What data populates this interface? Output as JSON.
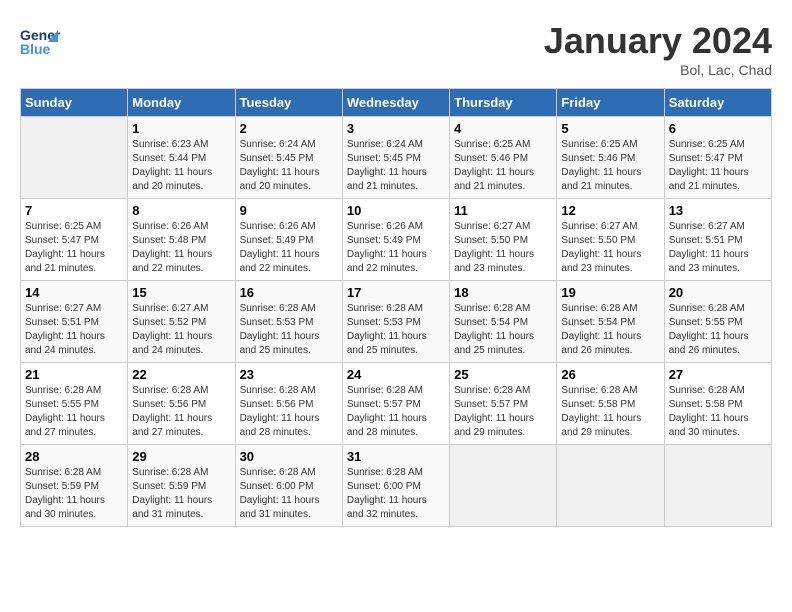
{
  "header": {
    "logo_text_general": "General",
    "logo_text_blue": "Blue",
    "title": "January 2024",
    "location": "Bol, Lac, Chad"
  },
  "days_of_week": [
    "Sunday",
    "Monday",
    "Tuesday",
    "Wednesday",
    "Thursday",
    "Friday",
    "Saturday"
  ],
  "weeks": [
    [
      {
        "num": "",
        "sunrise": "",
        "sunset": "",
        "daylight": ""
      },
      {
        "num": "1",
        "sunrise": "Sunrise: 6:23 AM",
        "sunset": "Sunset: 5:44 PM",
        "daylight": "Daylight: 11 hours and 20 minutes."
      },
      {
        "num": "2",
        "sunrise": "Sunrise: 6:24 AM",
        "sunset": "Sunset: 5:45 PM",
        "daylight": "Daylight: 11 hours and 20 minutes."
      },
      {
        "num": "3",
        "sunrise": "Sunrise: 6:24 AM",
        "sunset": "Sunset: 5:45 PM",
        "daylight": "Daylight: 11 hours and 21 minutes."
      },
      {
        "num": "4",
        "sunrise": "Sunrise: 6:25 AM",
        "sunset": "Sunset: 5:46 PM",
        "daylight": "Daylight: 11 hours and 21 minutes."
      },
      {
        "num": "5",
        "sunrise": "Sunrise: 6:25 AM",
        "sunset": "Sunset: 5:46 PM",
        "daylight": "Daylight: 11 hours and 21 minutes."
      },
      {
        "num": "6",
        "sunrise": "Sunrise: 6:25 AM",
        "sunset": "Sunset: 5:47 PM",
        "daylight": "Daylight: 11 hours and 21 minutes."
      }
    ],
    [
      {
        "num": "7",
        "sunrise": "Sunrise: 6:25 AM",
        "sunset": "Sunset: 5:47 PM",
        "daylight": "Daylight: 11 hours and 21 minutes."
      },
      {
        "num": "8",
        "sunrise": "Sunrise: 6:26 AM",
        "sunset": "Sunset: 5:48 PM",
        "daylight": "Daylight: 11 hours and 22 minutes."
      },
      {
        "num": "9",
        "sunrise": "Sunrise: 6:26 AM",
        "sunset": "Sunset: 5:49 PM",
        "daylight": "Daylight: 11 hours and 22 minutes."
      },
      {
        "num": "10",
        "sunrise": "Sunrise: 6:26 AM",
        "sunset": "Sunset: 5:49 PM",
        "daylight": "Daylight: 11 hours and 22 minutes."
      },
      {
        "num": "11",
        "sunrise": "Sunrise: 6:27 AM",
        "sunset": "Sunset: 5:50 PM",
        "daylight": "Daylight: 11 hours and 23 minutes."
      },
      {
        "num": "12",
        "sunrise": "Sunrise: 6:27 AM",
        "sunset": "Sunset: 5:50 PM",
        "daylight": "Daylight: 11 hours and 23 minutes."
      },
      {
        "num": "13",
        "sunrise": "Sunrise: 6:27 AM",
        "sunset": "Sunset: 5:51 PM",
        "daylight": "Daylight: 11 hours and 23 minutes."
      }
    ],
    [
      {
        "num": "14",
        "sunrise": "Sunrise: 6:27 AM",
        "sunset": "Sunset: 5:51 PM",
        "daylight": "Daylight: 11 hours and 24 minutes."
      },
      {
        "num": "15",
        "sunrise": "Sunrise: 6:27 AM",
        "sunset": "Sunset: 5:52 PM",
        "daylight": "Daylight: 11 hours and 24 minutes."
      },
      {
        "num": "16",
        "sunrise": "Sunrise: 6:28 AM",
        "sunset": "Sunset: 5:53 PM",
        "daylight": "Daylight: 11 hours and 25 minutes."
      },
      {
        "num": "17",
        "sunrise": "Sunrise: 6:28 AM",
        "sunset": "Sunset: 5:53 PM",
        "daylight": "Daylight: 11 hours and 25 minutes."
      },
      {
        "num": "18",
        "sunrise": "Sunrise: 6:28 AM",
        "sunset": "Sunset: 5:54 PM",
        "daylight": "Daylight: 11 hours and 25 minutes."
      },
      {
        "num": "19",
        "sunrise": "Sunrise: 6:28 AM",
        "sunset": "Sunset: 5:54 PM",
        "daylight": "Daylight: 11 hours and 26 minutes."
      },
      {
        "num": "20",
        "sunrise": "Sunrise: 6:28 AM",
        "sunset": "Sunset: 5:55 PM",
        "daylight": "Daylight: 11 hours and 26 minutes."
      }
    ],
    [
      {
        "num": "21",
        "sunrise": "Sunrise: 6:28 AM",
        "sunset": "Sunset: 5:55 PM",
        "daylight": "Daylight: 11 hours and 27 minutes."
      },
      {
        "num": "22",
        "sunrise": "Sunrise: 6:28 AM",
        "sunset": "Sunset: 5:56 PM",
        "daylight": "Daylight: 11 hours and 27 minutes."
      },
      {
        "num": "23",
        "sunrise": "Sunrise: 6:28 AM",
        "sunset": "Sunset: 5:56 PM",
        "daylight": "Daylight: 11 hours and 28 minutes."
      },
      {
        "num": "24",
        "sunrise": "Sunrise: 6:28 AM",
        "sunset": "Sunset: 5:57 PM",
        "daylight": "Daylight: 11 hours and 28 minutes."
      },
      {
        "num": "25",
        "sunrise": "Sunrise: 6:28 AM",
        "sunset": "Sunset: 5:57 PM",
        "daylight": "Daylight: 11 hours and 29 minutes."
      },
      {
        "num": "26",
        "sunrise": "Sunrise: 6:28 AM",
        "sunset": "Sunset: 5:58 PM",
        "daylight": "Daylight: 11 hours and 29 minutes."
      },
      {
        "num": "27",
        "sunrise": "Sunrise: 6:28 AM",
        "sunset": "Sunset: 5:58 PM",
        "daylight": "Daylight: 11 hours and 30 minutes."
      }
    ],
    [
      {
        "num": "28",
        "sunrise": "Sunrise: 6:28 AM",
        "sunset": "Sunset: 5:59 PM",
        "daylight": "Daylight: 11 hours and 30 minutes."
      },
      {
        "num": "29",
        "sunrise": "Sunrise: 6:28 AM",
        "sunset": "Sunset: 5:59 PM",
        "daylight": "Daylight: 11 hours and 31 minutes."
      },
      {
        "num": "30",
        "sunrise": "Sunrise: 6:28 AM",
        "sunset": "Sunset: 6:00 PM",
        "daylight": "Daylight: 11 hours and 31 minutes."
      },
      {
        "num": "31",
        "sunrise": "Sunrise: 6:28 AM",
        "sunset": "Sunset: 6:00 PM",
        "daylight": "Daylight: 11 hours and 32 minutes."
      },
      {
        "num": "",
        "sunrise": "",
        "sunset": "",
        "daylight": ""
      },
      {
        "num": "",
        "sunrise": "",
        "sunset": "",
        "daylight": ""
      },
      {
        "num": "",
        "sunrise": "",
        "sunset": "",
        "daylight": ""
      }
    ]
  ]
}
